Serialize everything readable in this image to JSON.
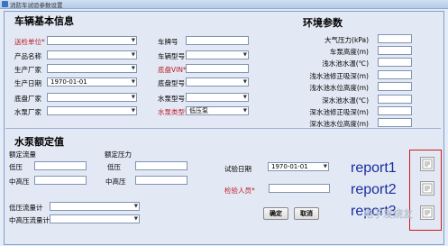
{
  "window": {
    "title": "消防车试验参数设置"
  },
  "vehicle": {
    "title": "车辆基本信息",
    "left_fields": [
      {
        "label": "送检单位*",
        "required": true,
        "value": ""
      },
      {
        "label": "产品名称",
        "required": false,
        "value": ""
      },
      {
        "label": "生产厂家",
        "required": false,
        "value": ""
      },
      {
        "label": "生产日期",
        "required": false,
        "value": "1970-01-01"
      },
      {
        "label": "底盘厂家",
        "required": false,
        "value": ""
      },
      {
        "label": "水泵厂家",
        "required": false,
        "value": ""
      }
    ],
    "right_fields": [
      {
        "label": "车牌号",
        "required": false,
        "value": ""
      },
      {
        "label": "车辆型号",
        "required": false,
        "value": ""
      },
      {
        "label": "底盘VIN*",
        "required": true,
        "value": ""
      },
      {
        "label": "底盘型号",
        "required": false,
        "value": ""
      },
      {
        "label": "水泵型号",
        "required": false,
        "value": ""
      },
      {
        "label": "水泵类型*",
        "required": true,
        "value": "低压泵"
      }
    ]
  },
  "env": {
    "title": "环境参数",
    "fields": [
      {
        "label": "大气压力(kPa)",
        "value": ""
      },
      {
        "label": "车泵高度(m)",
        "value": ""
      },
      {
        "label": "浅水池水温(℃)",
        "value": ""
      },
      {
        "label": "浅水池修正吸深(m)",
        "value": ""
      },
      {
        "label": "浅水池水位高度(m)",
        "value": ""
      },
      {
        "label": "深水池水温(℃)",
        "value": ""
      },
      {
        "label": "深水池修正吸深(m)",
        "value": ""
      },
      {
        "label": "深水池水位高度(m)",
        "value": ""
      }
    ]
  },
  "pump": {
    "title": "水泵额定值",
    "flow_header": "额定流量",
    "pressure_header": "额定压力",
    "low_label": "低压",
    "midhigh_label": "中高压",
    "low_flowmeter_label": "低压流量计",
    "midhigh_flowmeter_label": "中高压流量计"
  },
  "test": {
    "date_label": "试验日期",
    "date_value": "1970-01-01",
    "inspector_label": "检验人员*",
    "inspector_value": "",
    "confirm_label": "确定",
    "cancel_label": "取消"
  },
  "annotations": {
    "r1": "report1",
    "r2": "report2",
    "r3": "report3"
  },
  "watermark": "电子发烧友",
  "colors": {
    "required": "#c0202a",
    "annotation": "#1a2ea0",
    "box": "#d01818"
  }
}
